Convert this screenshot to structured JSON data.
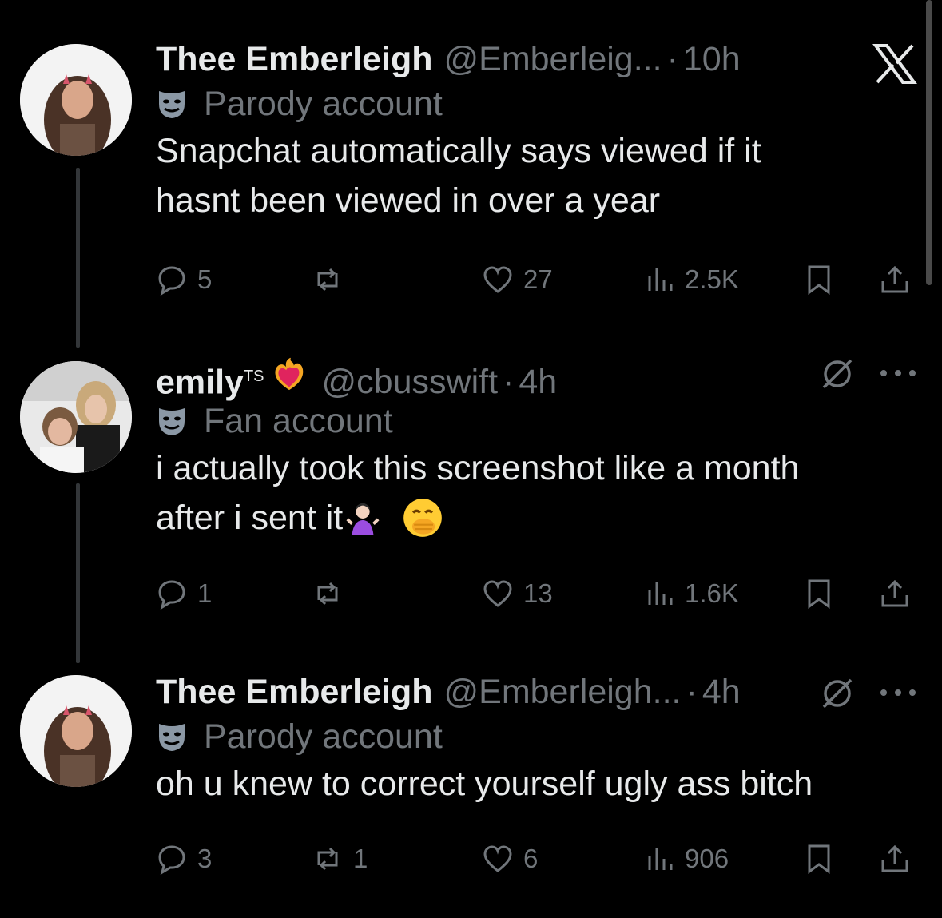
{
  "tweets": [
    {
      "name": "Thee Emberleigh",
      "handle": "@Emberleig...",
      "time": "10h",
      "badge": "Parody account",
      "text_lines": [
        "Snapchat automatically says viewed if it",
        "hasnt been viewed in over a year"
      ],
      "replies": "5",
      "reposts": "",
      "likes": "27",
      "views": "2.5K"
    },
    {
      "name": "emily",
      "name_suffix": "TS",
      "handle": "@cbusswift",
      "time": "4h",
      "badge": "Fan account",
      "text_lines": [
        "i actually took this screenshot like a month",
        "after i sent it"
      ],
      "replies": "1",
      "reposts": "",
      "likes": "13",
      "views": "1.6K"
    },
    {
      "name": "Thee Emberleigh",
      "handle": "@Emberleigh...",
      "time": "4h",
      "badge": "Parody account",
      "text_lines": [
        "oh u knew to correct yourself ugly ass bitch"
      ],
      "replies": "3",
      "reposts": "1",
      "likes": "6",
      "views": "906"
    }
  ],
  "icons": {
    "reply": "speech-bubble",
    "repost": "repost-arrows",
    "like": "heart",
    "views": "bar-chart",
    "bookmark": "bookmark",
    "share": "share-arrow",
    "more": "ellipsis",
    "muted": "circle-slash",
    "brand": "x-logo"
  },
  "colors": {
    "background": "#000000",
    "text": "#e7e9ea",
    "muted": "#71767b",
    "divider": "#333639"
  }
}
